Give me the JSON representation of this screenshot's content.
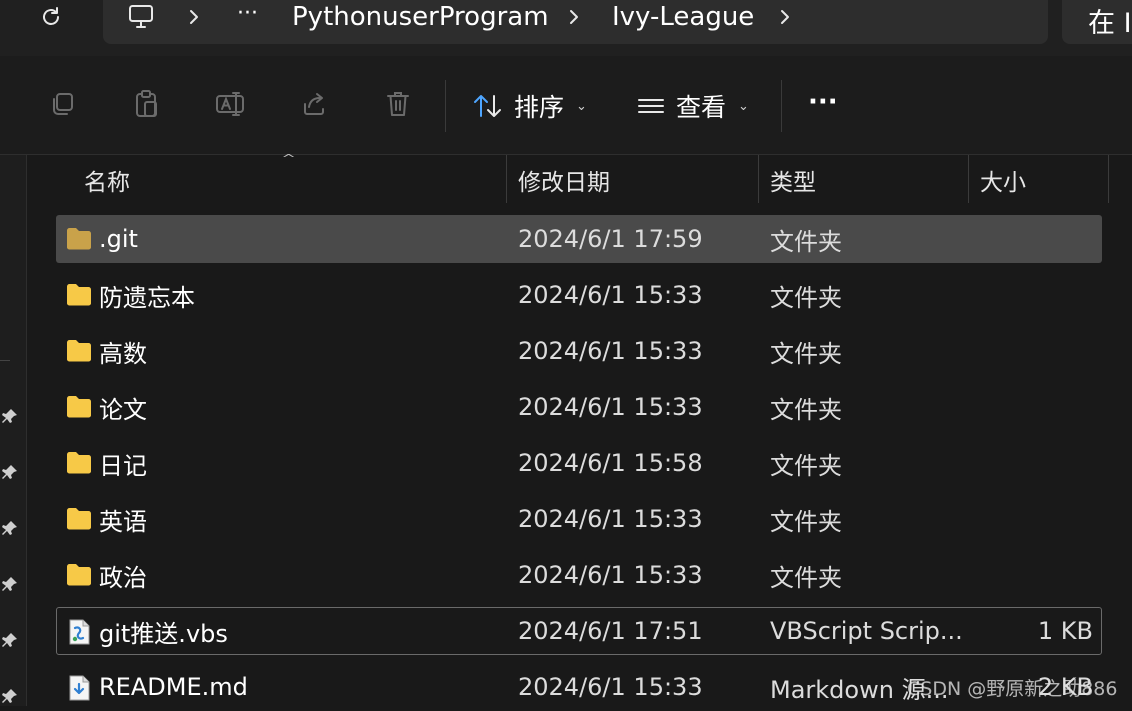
{
  "address_bar": {
    "refresh_icon": "refresh-icon",
    "device_icon": "monitor-icon",
    "overflow": "···",
    "crumbs": [
      "PythonuserProgram",
      "Ivy-League"
    ],
    "search_placeholder": "在 I"
  },
  "toolbar": {
    "icons": [
      "copy-icon",
      "paste-icon",
      "rename-icon",
      "share-icon",
      "delete-icon"
    ],
    "sort_label": "排序",
    "view_label": "查看",
    "more_label": "···"
  },
  "columns": {
    "name": "名称",
    "modified": "修改日期",
    "type": "类型",
    "size": "大小",
    "sort_indicator": "^"
  },
  "files": [
    {
      "name": ".git",
      "modified": "2024/6/1 17:59",
      "type": "文件夹",
      "size": "",
      "icon": "folder-icon",
      "selected": true
    },
    {
      "name": "防遗忘本",
      "modified": "2024/6/1 15:33",
      "type": "文件夹",
      "size": "",
      "icon": "folder-icon"
    },
    {
      "name": "高数",
      "modified": "2024/6/1 15:33",
      "type": "文件夹",
      "size": "",
      "icon": "folder-icon"
    },
    {
      "name": "论文",
      "modified": "2024/6/1 15:33",
      "type": "文件夹",
      "size": "",
      "icon": "folder-icon"
    },
    {
      "name": "日记",
      "modified": "2024/6/1 15:58",
      "type": "文件夹",
      "size": "",
      "icon": "folder-icon"
    },
    {
      "name": "英语",
      "modified": "2024/6/1 15:33",
      "type": "文件夹",
      "size": "",
      "icon": "folder-icon"
    },
    {
      "name": "政治",
      "modified": "2024/6/1 15:33",
      "type": "文件夹",
      "size": "",
      "icon": "folder-icon"
    },
    {
      "name": "git推送.vbs",
      "modified": "2024/6/1 17:51",
      "type": "VBScript Scrip...",
      "size": "1 KB",
      "icon": "vbscript-file-icon",
      "focused": true
    },
    {
      "name": "README.md",
      "modified": "2024/6/1 15:33",
      "type": "Markdown 源...",
      "size": "2 KB",
      "icon": "markdown-file-icon"
    }
  ],
  "watermark": "CSDN @野原新之助886",
  "colors": {
    "background": "#191919",
    "selected_row": "#4a4a4a",
    "folder": "#f7c948",
    "accent": "#4ea5ff"
  }
}
